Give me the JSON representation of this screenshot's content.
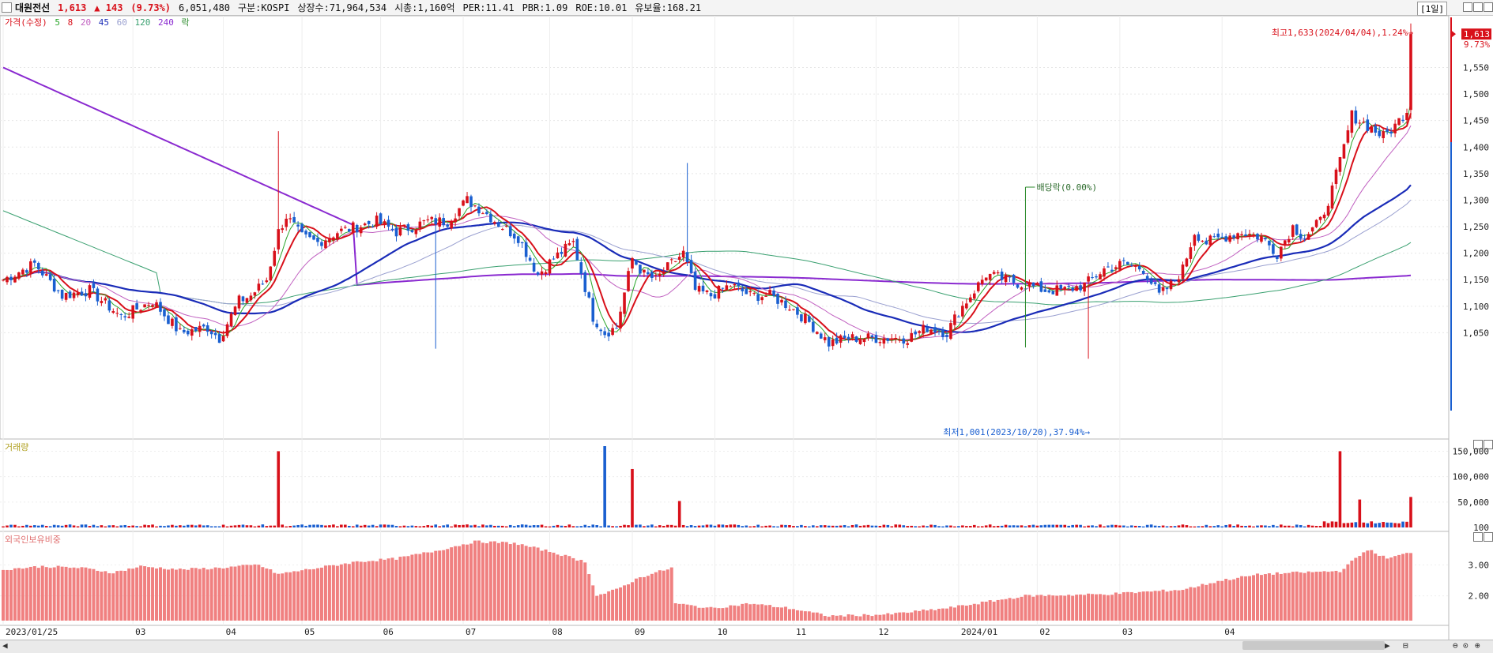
{
  "header": {
    "name": "대원전선",
    "price": "1,613",
    "change": "▲ 143",
    "change_pct": "(9.73%)",
    "volume": "6,051,480",
    "market": "구분:KOSPI",
    "listed": "상장수:71,964,534",
    "mcap": "시총:1,160억",
    "per": "PER:11.41",
    "pbr": "PBR:1.09",
    "roe": "ROE:10.01",
    "retention": "유보율:168.21",
    "timeframe": "[1일]"
  },
  "price_legend": {
    "price": "가격(수정)",
    "ma5": "5",
    "ma8": "8",
    "ma20": "20",
    "ma45": "45",
    "ma60": "60",
    "ma120": "120",
    "ma240": "240",
    "ex": "락"
  },
  "colors": {
    "up": "#d8101a",
    "down": "#1a5fd0",
    "ma5": "#2aa52a",
    "ma8": "#d8101a",
    "ma20": "#c060c0",
    "ma45": "#1a2cb8",
    "ma60": "#9aa0d0",
    "ma120": "#3aa070",
    "ma240": "#8a2ad0",
    "foreign": "#f08080"
  },
  "annotations": {
    "high": "최고1,633(2024/04/04),1.24%→",
    "low": "최저1,001(2023/10/20),37.94%→",
    "dividend": "배당락(0.00%)",
    "last_price": "1,613",
    "last_pct": "9.73%"
  },
  "volume_legend": "거래량",
  "foreign_legend": "외국인보유비중",
  "chart_data": [
    {
      "type": "candlestick",
      "title": "가격(수정)",
      "y_ticks": [
        1050,
        1100,
        1150,
        1200,
        1250,
        1300,
        1350,
        1400,
        1450,
        1500,
        1550
      ],
      "ylim": [
        1000,
        1640
      ],
      "x_ticks": [
        "2023/01/25",
        "03",
        "04",
        "05",
        "06",
        "07",
        "08",
        "09",
        "10",
        "11",
        "12",
        "2024/01",
        "02",
        "03",
        "04"
      ],
      "high": {
        "value": 1633,
        "date": "2024/04/04"
      },
      "low": {
        "value": 1001,
        "date": "2023/10/20"
      },
      "last_close": 1613,
      "anchors": [
        [
          0,
          1150
        ],
        [
          8,
          1180
        ],
        [
          15,
          1120
        ],
        [
          22,
          1130
        ],
        [
          30,
          1080
        ],
        [
          38,
          1110
        ],
        [
          45,
          1050
        ],
        [
          52,
          1060
        ],
        [
          55,
          1040
        ],
        [
          60,
          1110
        ],
        [
          63,
          1120
        ],
        [
          67,
          1150
        ],
        [
          70,
          1240
        ],
        [
          72,
          1270
        ],
        [
          76,
          1230
        ],
        [
          80,
          1220
        ],
        [
          85,
          1240
        ],
        [
          90,
          1250
        ],
        [
          95,
          1260
        ],
        [
          100,
          1240
        ],
        [
          104,
          1250
        ],
        [
          108,
          1260
        ],
        [
          113,
          1260
        ],
        [
          118,
          1300
        ],
        [
          122,
          1280
        ],
        [
          127,
          1250
        ],
        [
          131,
          1230
        ],
        [
          136,
          1160
        ],
        [
          140,
          1190
        ],
        [
          145,
          1220
        ],
        [
          150,
          1080
        ],
        [
          153,
          1050
        ],
        [
          156,
          1060
        ],
        [
          160,
          1190
        ],
        [
          163,
          1160
        ],
        [
          166,
          1150
        ],
        [
          170,
          1180
        ],
        [
          173,
          1200
        ],
        [
          176,
          1130
        ],
        [
          180,
          1120
        ],
        [
          185,
          1140
        ],
        [
          190,
          1120
        ],
        [
          195,
          1120
        ],
        [
          200,
          1100
        ],
        [
          205,
          1070
        ],
        [
          210,
          1030
        ],
        [
          215,
          1040
        ],
        [
          220,
          1040
        ],
        [
          225,
          1040
        ],
        [
          230,
          1040
        ],
        [
          235,
          1060
        ],
        [
          240,
          1050
        ],
        [
          243,
          1090
        ],
        [
          246,
          1120
        ],
        [
          250,
          1160
        ],
        [
          255,
          1150
        ],
        [
          260,
          1140
        ],
        [
          265,
          1130
        ],
        [
          270,
          1130
        ],
        [
          275,
          1140
        ],
        [
          280,
          1170
        ],
        [
          285,
          1180
        ],
        [
          290,
          1170
        ],
        [
          294,
          1120
        ],
        [
          297,
          1140
        ],
        [
          300,
          1170
        ],
        [
          303,
          1240
        ],
        [
          306,
          1220
        ],
        [
          310,
          1230
        ],
        [
          315,
          1240
        ],
        [
          320,
          1230
        ],
        [
          324,
          1200
        ],
        [
          328,
          1250
        ],
        [
          331,
          1230
        ],
        [
          335,
          1260
        ],
        [
          338,
          1320
        ],
        [
          341,
          1400
        ],
        [
          343,
          1460
        ],
        [
          347,
          1440
        ],
        [
          351,
          1420
        ],
        [
          354,
          1440
        ],
        [
          357,
          1470
        ],
        [
          358,
          1613
        ]
      ]
    },
    {
      "type": "bar",
      "title": "거래량",
      "y_ticks": [
        100,
        50000,
        100000,
        150000
      ],
      "spikes": [
        {
          "i": 70,
          "v": 150000
        },
        {
          "i": 153,
          "v": 160000
        },
        {
          "i": 160,
          "v": 115000
        },
        {
          "i": 172,
          "v": 52000
        },
        {
          "i": 340,
          "v": 150000
        },
        {
          "i": 345,
          "v": 55000
        },
        {
          "i": 358,
          "v": 60000
        }
      ]
    },
    {
      "type": "bar",
      "title": "외국인보유비중",
      "y_ticks": [
        2.0,
        3.0
      ],
      "ylim": [
        1.2,
        3.9
      ],
      "anchors": [
        [
          0,
          2.85
        ],
        [
          10,
          2.95
        ],
        [
          20,
          2.9
        ],
        [
          28,
          2.75
        ],
        [
          35,
          2.95
        ],
        [
          45,
          2.85
        ],
        [
          55,
          2.9
        ],
        [
          65,
          3.0
        ],
        [
          70,
          2.7
        ],
        [
          80,
          2.9
        ],
        [
          90,
          3.1
        ],
        [
          100,
          3.2
        ],
        [
          110,
          3.45
        ],
        [
          120,
          3.75
        ],
        [
          130,
          3.7
        ],
        [
          140,
          3.4
        ],
        [
          148,
          3.1
        ],
        [
          151,
          2.0
        ],
        [
          156,
          2.2
        ],
        [
          162,
          2.6
        ],
        [
          170,
          2.9
        ],
        [
          171,
          1.75
        ],
        [
          180,
          1.6
        ],
        [
          190,
          1.75
        ],
        [
          200,
          1.6
        ],
        [
          210,
          1.35
        ],
        [
          225,
          1.4
        ],
        [
          240,
          1.6
        ],
        [
          260,
          2.0
        ],
        [
          280,
          2.05
        ],
        [
          300,
          2.2
        ],
        [
          310,
          2.5
        ],
        [
          320,
          2.7
        ],
        [
          330,
          2.75
        ],
        [
          340,
          2.8
        ],
        [
          347,
          3.5
        ],
        [
          352,
          3.2
        ],
        [
          358,
          3.4
        ]
      ]
    }
  ]
}
